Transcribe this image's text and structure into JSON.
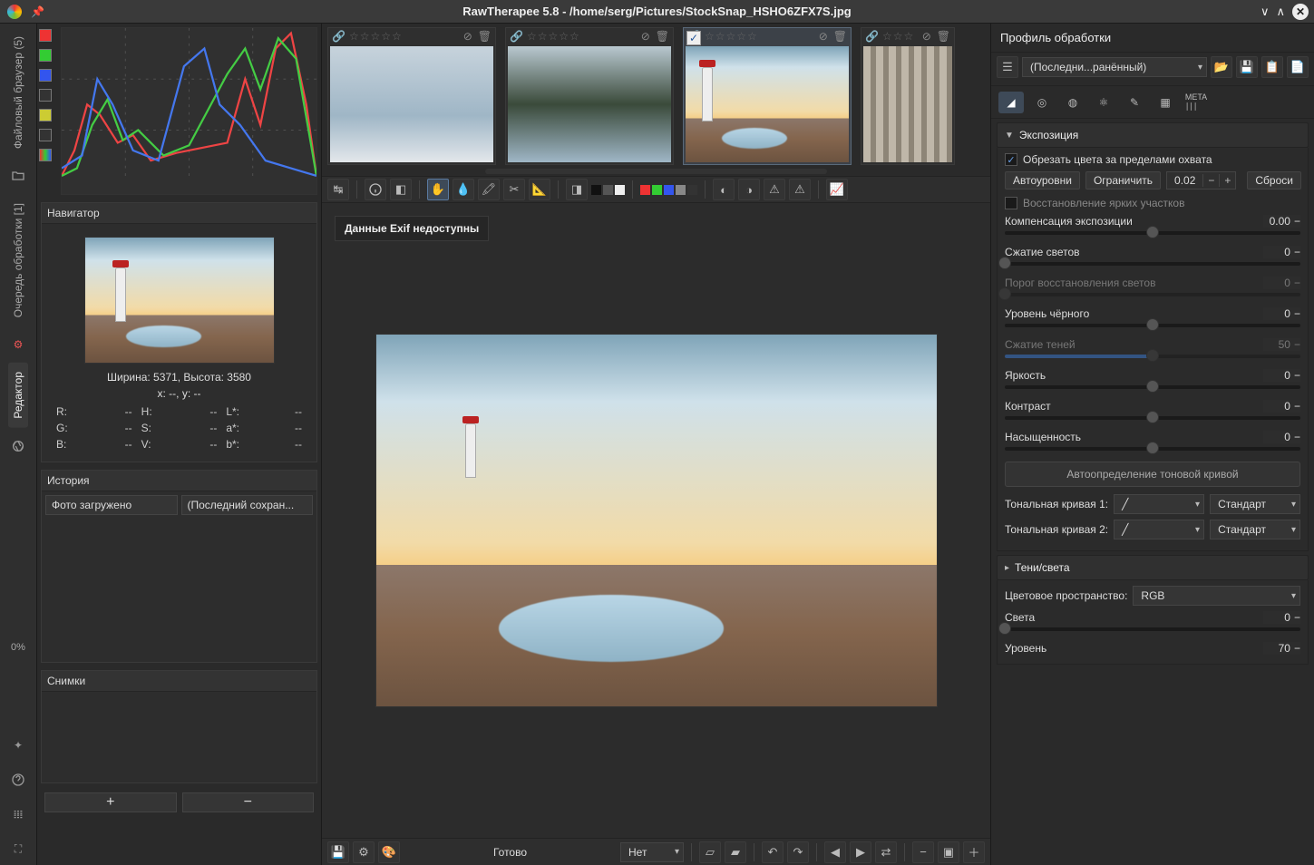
{
  "window": {
    "title": "RawTherapee 5.8 - /home/serg/Pictures/StockSnap_HSHO6ZFX7S.jpg"
  },
  "left_tabs": {
    "file_browser": "Файловый браузер (5)",
    "queue": "Очередь обработки [1]",
    "editor": "Редактор",
    "progress": "0%"
  },
  "navigator": {
    "title": "Навигатор",
    "dims": "Ширина: 5371, Высота: 3580",
    "xy": "x: --, y: --",
    "r": {
      "label": "R:",
      "v": "--"
    },
    "g": {
      "label": "G:",
      "v": "--"
    },
    "b": {
      "label": "B:",
      "v": "--"
    },
    "h": {
      "label": "H:",
      "v": "--"
    },
    "s": {
      "label": "S:",
      "v": "--"
    },
    "v": {
      "label": "V:",
      "v": "--"
    },
    "L": {
      "label": "L*:",
      "v": "--"
    },
    "a": {
      "label": "a*:",
      "v": "--"
    },
    "bb": {
      "label": "b*:",
      "v": "--"
    }
  },
  "history": {
    "title": "История",
    "item": "Фото загружено",
    "profile": "(Последний сохран..."
  },
  "snapshots": {
    "title": "Снимки"
  },
  "thumbstrip": {
    "t1_title": "",
    "t2_title": "",
    "t3_title": "",
    "t4_title": ""
  },
  "preview": {
    "exif_msg": "Данные Exif недоступны"
  },
  "bottom": {
    "status": "Готово",
    "combo": "Нет"
  },
  "right": {
    "profile_label": "Профиль обработки",
    "profile_combo": "(Последни...ранённый)",
    "exposure": {
      "title": "Экспозиция",
      "clip": "Обрезать цвета за пределами охвата",
      "autolevels": "Автоуровни",
      "clip_btn": "Ограничить",
      "clip_val": "0.02",
      "reset": "Сброси",
      "highlight_rec": "Восстановление ярких участков",
      "exp_comp_label": "Компенсация экспозиции",
      "exp_comp_val": "0.00",
      "hl_comp_label": "Сжатие светов",
      "hl_comp_val": "0",
      "hl_thr_label": "Порог восстановления светов",
      "hl_thr_val": "0",
      "black_label": "Уровень чёрного",
      "black_val": "0",
      "sh_comp_label": "Сжатие теней",
      "sh_comp_val": "50",
      "bright_label": "Яркость",
      "bright_val": "0",
      "contr_label": "Контраст",
      "contr_val": "0",
      "sat_label": "Насыщенность",
      "sat_val": "0",
      "auto_tc": "Автоопределение тоновой кривой",
      "tc1_label": "Тональная кривая 1:",
      "tc1_mode": "Стандарт",
      "tc2_label": "Тональная кривая 2:",
      "tc2_mode": "Стандарт"
    },
    "shadows": {
      "title": "Тени/света",
      "colorspace_label": "Цветовое пространство:",
      "colorspace": "RGB",
      "hl_label": "Света",
      "hl_val": "0",
      "lvl_label": "Уровень",
      "lvl_val": "70"
    }
  }
}
